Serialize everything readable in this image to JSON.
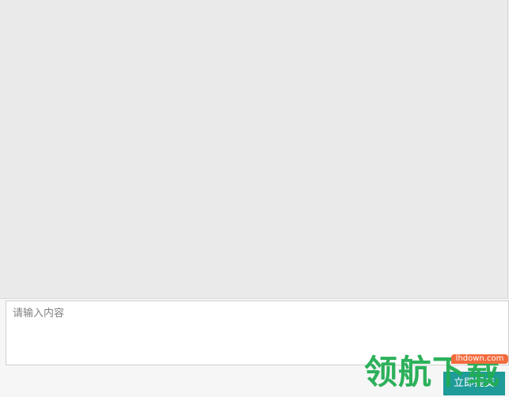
{
  "input": {
    "placeholder": "请输入内容"
  },
  "actions": {
    "submit_label": "立即提交"
  },
  "watermark": {
    "brand": "领航下载",
    "site": "lhdown.com"
  },
  "colors": {
    "chat_background": "#eaeaea",
    "submit_button": "#1f9b99",
    "watermark_green": "#22ad53",
    "watermark_orange": "#f26b3d"
  }
}
